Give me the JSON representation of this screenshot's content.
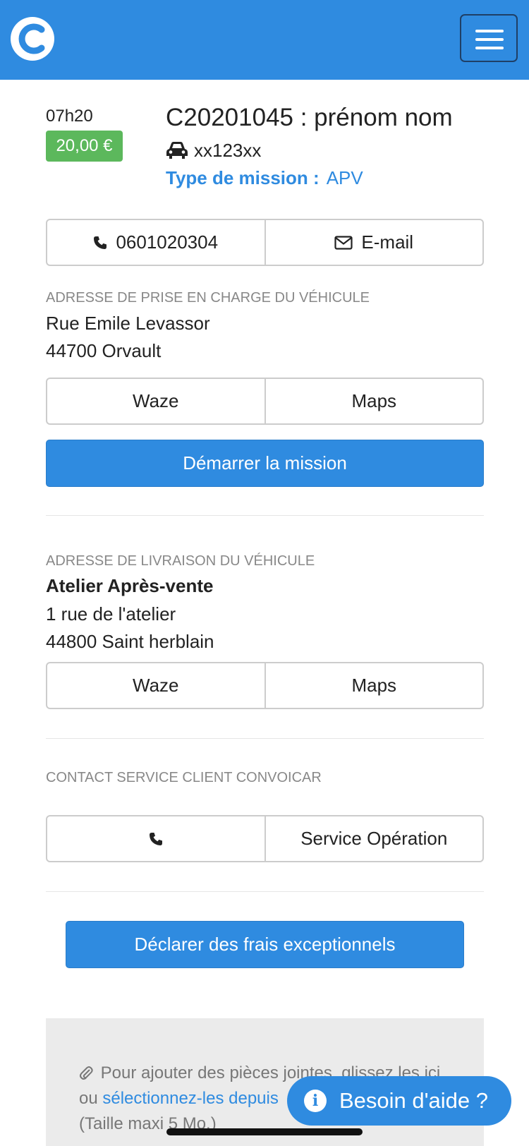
{
  "header": {
    "logo_icon": "convoicar-logo-icon",
    "menu_icon": "hamburger-menu-icon",
    "brand_color": "#2f8be0"
  },
  "mission": {
    "time": "07h20",
    "price": "20,00 €",
    "title": "C20201045 : prénom nom",
    "plate": "xx123xx",
    "plate_icon": "car-icon",
    "type_label": "Type de mission :",
    "type_value": "APV"
  },
  "contact": {
    "phone": "0601020304",
    "phone_icon": "phone-icon",
    "email_label": "E-mail",
    "email_icon": "envelope-icon"
  },
  "pickup": {
    "section_label": "ADRESSE DE PRISE EN CHARGE DU VÉHICULE",
    "line1": "Rue Emile Levassor",
    "line2": "44700 Orvault",
    "waze_label": "Waze",
    "maps_label": "Maps",
    "start_label": "Démarrer la mission"
  },
  "delivery": {
    "section_label": "ADRESSE DE LIVRAISON DU VÉHICULE",
    "name": "Atelier Après-vente",
    "line1": "1 rue de l'atelier",
    "line2": "44800 Saint herblain",
    "waze_label": "Waze",
    "maps_label": "Maps"
  },
  "service": {
    "section_label": "CONTACT SERVICE CLIENT CONVOICAR",
    "phone_icon": "phone-icon",
    "operation_label": "Service Opération"
  },
  "fees": {
    "declare_label": "Déclarer des frais exceptionnels"
  },
  "attachments": {
    "icon": "paperclip-icon",
    "text_part1": "Pour ajouter des pièces jointes, glissez les ici ou",
    "link_text": "sélectionnez-les depuis",
    "size_text": "(Taille maxi 5 Mo.)"
  },
  "help": {
    "icon": "info-icon",
    "label": "Besoin d'aide ?"
  }
}
